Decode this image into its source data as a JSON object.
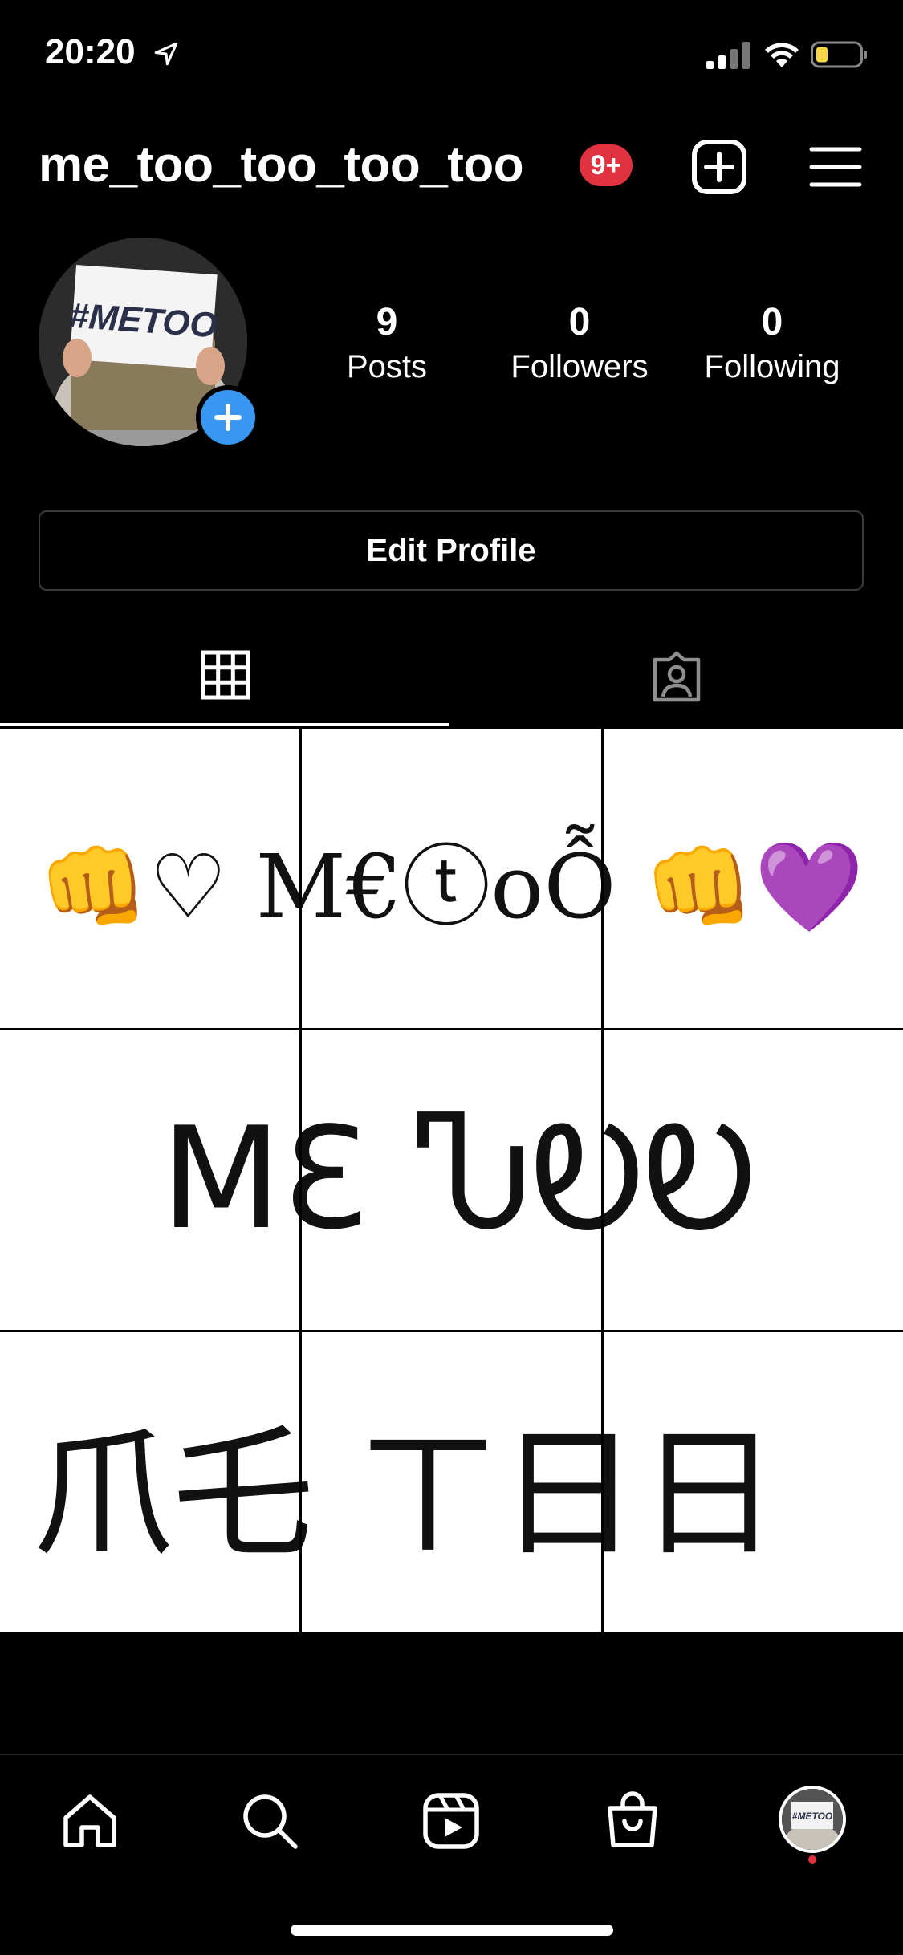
{
  "status_bar": {
    "time": "20:20",
    "battery_color": "#f5d547"
  },
  "header": {
    "username": "me_too_too_too_too",
    "notification_badge": "9+",
    "icons": [
      "plus-square-icon",
      "hamburger-menu-icon"
    ]
  },
  "profile": {
    "avatar_sign_text": "#METOO",
    "stats": [
      {
        "value": "9",
        "label": "Posts"
      },
      {
        "value": "0",
        "label": "Followers"
      },
      {
        "value": "0",
        "label": "Following"
      }
    ],
    "edit_button_label": "Edit Profile"
  },
  "tabs": {
    "items": [
      "grid-icon",
      "tagged-person-icon"
    ],
    "active_index": 0
  },
  "posts": {
    "rows": [
      {
        "text": "👊♡ M€ⓣoỖ 👊💜"
      },
      {
        "text": "MƐ ჀᎧᎧ"
      },
      {
        "text": "爪乇 ㄒ日日"
      }
    ]
  },
  "bottom_nav": {
    "items": [
      "home-icon",
      "search-icon",
      "reels-icon",
      "shop-icon",
      "profile-avatar"
    ],
    "accent_dot_color": "#e0333f"
  }
}
